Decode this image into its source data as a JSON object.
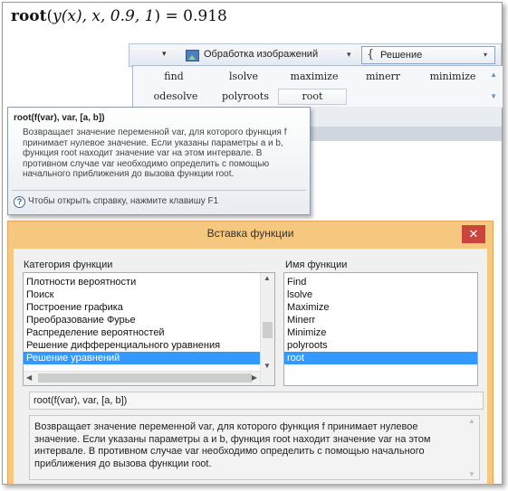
{
  "formula": {
    "fn": "root",
    "open": "(",
    "call": "y(x)",
    "args": ", x, 0.9, 1",
    "close": ")",
    "eq": "= 0.918"
  },
  "ribbon": {
    "image_processing_label": "Обработка изображений",
    "solve_label": "Решение",
    "gallery_items": [
      "find",
      "lsolve",
      "maximize",
      "minerr",
      "minimize",
      "odesolve",
      "polyroots",
      "root"
    ],
    "selected_item": "root"
  },
  "tooltip": {
    "title": "root(f(var), var, [a, b])",
    "body": "Возвращает значение переменной var, для которого функция f принимает нулевое значение. Если указаны параметры a и b, функция root находит значение var на этом интервале. В противном случае var необходимо определить с помощью начального приближения до вызова функции root.",
    "help": "Чтобы открыть справку, нажмите клавишу F1"
  },
  "dialog": {
    "title": "Вставка функции",
    "close_glyph": "✕",
    "category_label": "Категория функции",
    "categories": [
      "Плотности вероятности",
      "Поиск",
      "Построение графика",
      "Преобразование Фурье",
      "Распределение вероятностей",
      "Решение дифференциального уравнения",
      "Решение уравнений"
    ],
    "selected_category": "Решение уравнений",
    "function_label": "Имя функции",
    "functions": [
      "Find",
      "lsolve",
      "Maximize",
      "Minerr",
      "Minimize",
      "polyroots",
      "root"
    ],
    "selected_function": "root",
    "signature": "root(f(var), var, [a, b])",
    "description": "Возвращает значение переменной var, для которого функция f принимает нулевое значение. Если указаны параметры a и b, функция root находит значение var на этом интервале. В противном случае var необходимо определить с помощью начального приближения до вызова функции root."
  },
  "colors": {
    "dialog_frame": "#f5c77f",
    "selection": "#3399ff",
    "close_button": "#c9463d"
  }
}
